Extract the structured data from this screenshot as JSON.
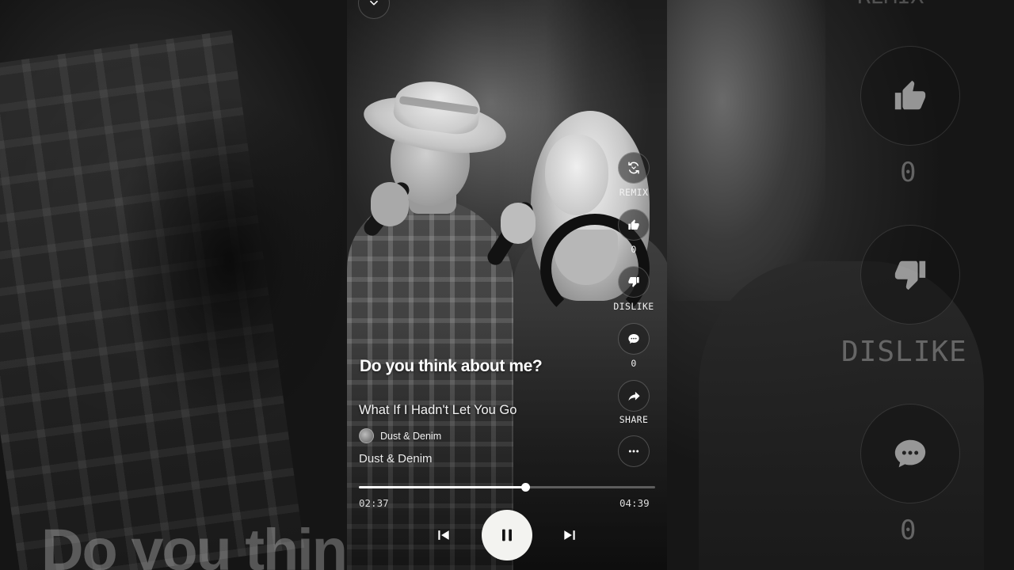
{
  "player": {
    "lyric_line": "Do you think about me?",
    "song_title": "What If I Hadn't Let You Go",
    "artist": "Dust & Denim",
    "album": "Dust & Denim",
    "time_elapsed": "02:37",
    "time_total": "04:39",
    "progress_fraction": 0.562
  },
  "actions": {
    "remix_label": "REMIX",
    "like_count": "0",
    "dislike_label": "DISLIKE",
    "comment_count": "0",
    "share_label": "SHARE"
  },
  "background": {
    "big_title": "Do you thin",
    "big_remix": "REMIX",
    "big_like_count": "0",
    "big_dislike_label": "DISLIKE",
    "big_comment_count": "0"
  },
  "icons": {
    "top": "chevron-down-icon",
    "remix": "remix-icon",
    "like": "thumbs-up-icon",
    "dislike": "thumbs-down-icon",
    "comment": "comment-icon",
    "share": "share-icon",
    "more": "more-icon",
    "prev": "skip-previous-icon",
    "play": "pause-icon",
    "next": "skip-next-icon"
  },
  "colors": {
    "accent": "#ffffff",
    "play_button": "#f3f3f0"
  }
}
